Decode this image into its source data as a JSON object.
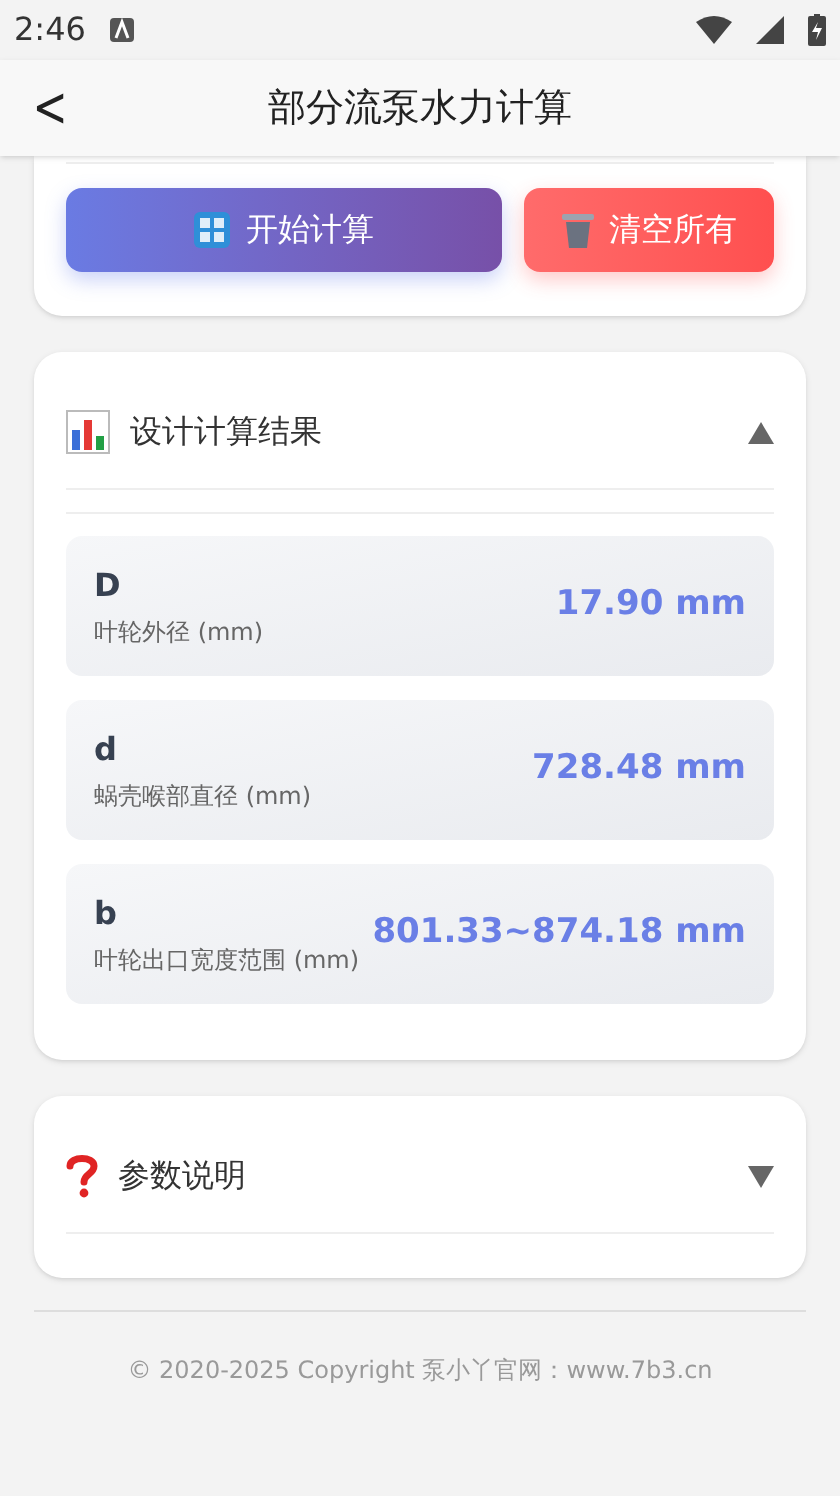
{
  "status_bar": {
    "time": "2:46"
  },
  "app_bar": {
    "back": "<",
    "title": "部分流泵水力计算"
  },
  "actions": [
    {
      "kind": "calculate",
      "label": "开始计算"
    },
    {
      "kind": "clear",
      "label": "清空所有"
    }
  ],
  "sections": [
    {
      "kind": "results",
      "title": "设计计算结果",
      "expanded": true,
      "results": [
        {
          "symbol": "D",
          "label": "叶轮外径 (mm)",
          "value": "17.90 mm"
        },
        {
          "symbol": "d",
          "label": "蜗壳喉部直径 (mm)",
          "value": "728.48 mm"
        },
        {
          "symbol": "b",
          "label": "叶轮出口宽度范围 (mm)",
          "value": "801.33~874.18 mm"
        }
      ]
    },
    {
      "kind": "help",
      "title": "参数说明",
      "expanded": false
    }
  ],
  "footer": "© 2020-2025 Copyright 泵小丫官网：www.7b3.cn"
}
